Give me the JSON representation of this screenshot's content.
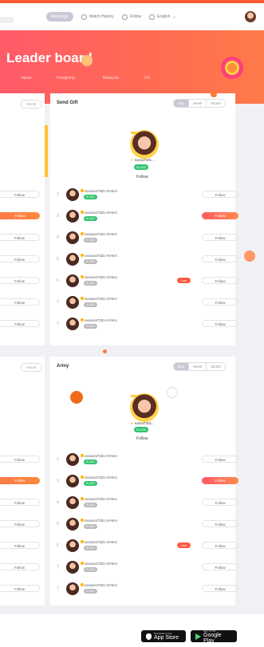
{
  "nav": {
    "active": "Recharge",
    "items": [
      "Watch History",
      "Follow",
      "English"
    ]
  },
  "hero": {
    "title": "Leader board",
    "tabs": [
      "Japan",
      "Hongkong",
      "Malaysia",
      "US"
    ]
  },
  "periods": [
    "Day",
    "Week",
    "Month"
  ],
  "left_period": "Month",
  "sections": [
    {
      "title": "Send Gift",
      "champion": {
        "name": "nama7331...",
        "badge": "51,632",
        "follow": "Follow"
      },
      "rows": [
        {
          "rank": "2",
          "name": "xxxxxxx7331 AYAKA",
          "badge": "51,632",
          "badge_color": "green",
          "live": "",
          "follow": "Follow",
          "hot": false
        },
        {
          "rank": "3",
          "name": "xxxxxxx7331 AYAKA",
          "badge": "51,632",
          "badge_color": "green",
          "live": "",
          "follow": "Follow",
          "hot": true
        },
        {
          "rank": "4",
          "name": "xxxxxxx7331 AYAKA",
          "badge": "51,632",
          "badge_color": "grey",
          "live": "",
          "follow": "Follow",
          "hot": false
        },
        {
          "rank": "5",
          "name": "xxxxxxx7331 AYAKA",
          "badge": "51,632",
          "badge_color": "grey",
          "live": "",
          "follow": "Follow",
          "hot": false
        },
        {
          "rank": "6",
          "name": "xxxxxxx7331 AYAKA",
          "badge": "51,632",
          "badge_color": "grey",
          "live": "Live",
          "follow": "Follow",
          "hot": false
        },
        {
          "rank": "7",
          "name": "xxxxxxx7331 AYAKA",
          "badge": "51,632",
          "badge_color": "grey",
          "live": "",
          "follow": "Follow",
          "hot": false
        },
        {
          "rank": "7",
          "name": "xxxxxxx7331 AYAKA",
          "badge": "51,632",
          "badge_color": "grey",
          "live": "",
          "follow": "Follow",
          "hot": false
        }
      ]
    },
    {
      "title": "Army",
      "champion": {
        "name": "nama7331...",
        "badge": "51,632",
        "follow": "Follow"
      },
      "rows": [
        {
          "rank": "2",
          "name": "xxxxxxx7331 AYAKA",
          "badge": "51,632",
          "badge_color": "green",
          "live": "",
          "follow": "Follow",
          "hot": false
        },
        {
          "rank": "3",
          "name": "xxxxxxx7331 AYAKA",
          "badge": "51,632",
          "badge_color": "green",
          "live": "",
          "follow": "Follow",
          "hot": true
        },
        {
          "rank": "4",
          "name": "xxxxxxx7331 AYAKA",
          "badge": "51,632",
          "badge_color": "grey",
          "live": "",
          "follow": "Follow",
          "hot": false
        },
        {
          "rank": "5",
          "name": "xxxxxxx7331 AYAKA",
          "badge": "51,632",
          "badge_color": "grey",
          "live": "",
          "follow": "Follow",
          "hot": false
        },
        {
          "rank": "6",
          "name": "xxxxxxx7331 AYAKA",
          "badge": "51,632",
          "badge_color": "grey",
          "live": "Live",
          "follow": "Follow",
          "hot": false
        },
        {
          "rank": "7",
          "name": "xxxxxxx7331 AYAKA",
          "badge": "51,632",
          "badge_color": "grey",
          "live": "",
          "follow": "Follow",
          "hot": false
        },
        {
          "rank": "7",
          "name": "xxxxxxx7331 AYAKA",
          "badge": "51,632",
          "badge_color": "grey",
          "live": "",
          "follow": "Follow",
          "hot": false
        }
      ]
    }
  ],
  "left_column_follow": "Follow",
  "footer": {
    "appstore_small": "Download on the",
    "appstore_big": "App Store",
    "play_small": "GET IT ON",
    "play_big": "Google Play"
  },
  "colors": {
    "accent": "#ff5a36",
    "green_badge": "#31c46e",
    "live": "#ff5a40",
    "gold": "#ffc233"
  }
}
